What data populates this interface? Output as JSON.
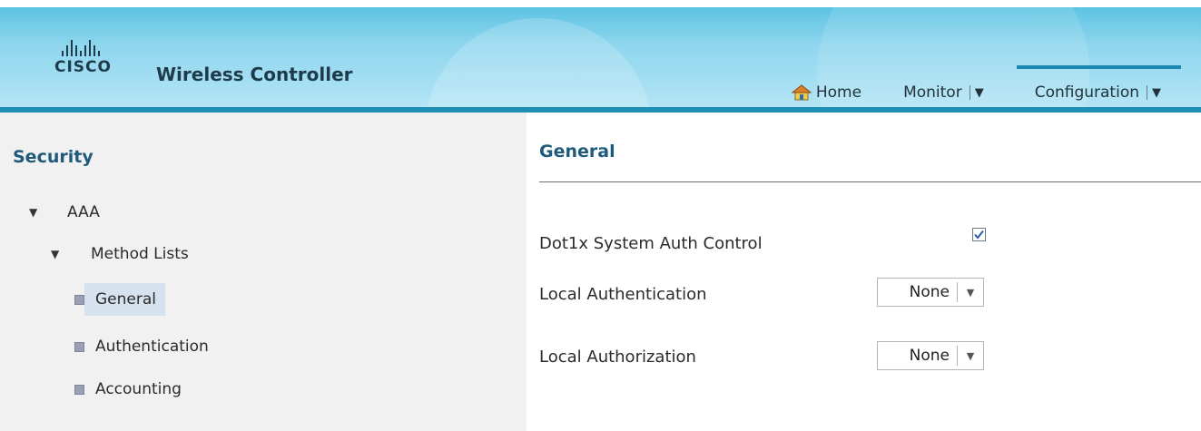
{
  "header": {
    "brand_word": "CISCO",
    "product_title": "Wireless Controller",
    "nav": {
      "home_label": "Home",
      "monitor_label": "Monitor",
      "configuration_label": "Configuration",
      "active": "Configuration"
    }
  },
  "sidebar": {
    "title": "Security",
    "tree": {
      "aaa_label": "AAA",
      "method_lists_label": "Method Lists",
      "items": [
        {
          "label": "General",
          "selected": true
        },
        {
          "label": "Authentication",
          "selected": false
        },
        {
          "label": "Accounting",
          "selected": false
        }
      ]
    }
  },
  "main": {
    "title": "General",
    "fields": {
      "dot1x_label": "Dot1x System Auth Control",
      "dot1x_checked": true,
      "local_authentication_label": "Local Authentication",
      "local_authentication_value": "None",
      "local_authorization_label": "Local Authorization",
      "local_authorization_value": "None"
    }
  },
  "icons": {
    "home": "home-icon",
    "caret": "caret-down-icon",
    "tree_expanded": "tree-expanded-icon",
    "tree_leaf": "tree-leaf-bullet-icon",
    "checkbox": "checkbox-checked-icon"
  },
  "colors": {
    "header_blue": "#5cc3e3",
    "accent_bar": "#1c87b1",
    "title_blue": "#1f5a7a",
    "selected_bg": "#d6e2ee",
    "sidebar_bg": "#f1f1f1"
  }
}
